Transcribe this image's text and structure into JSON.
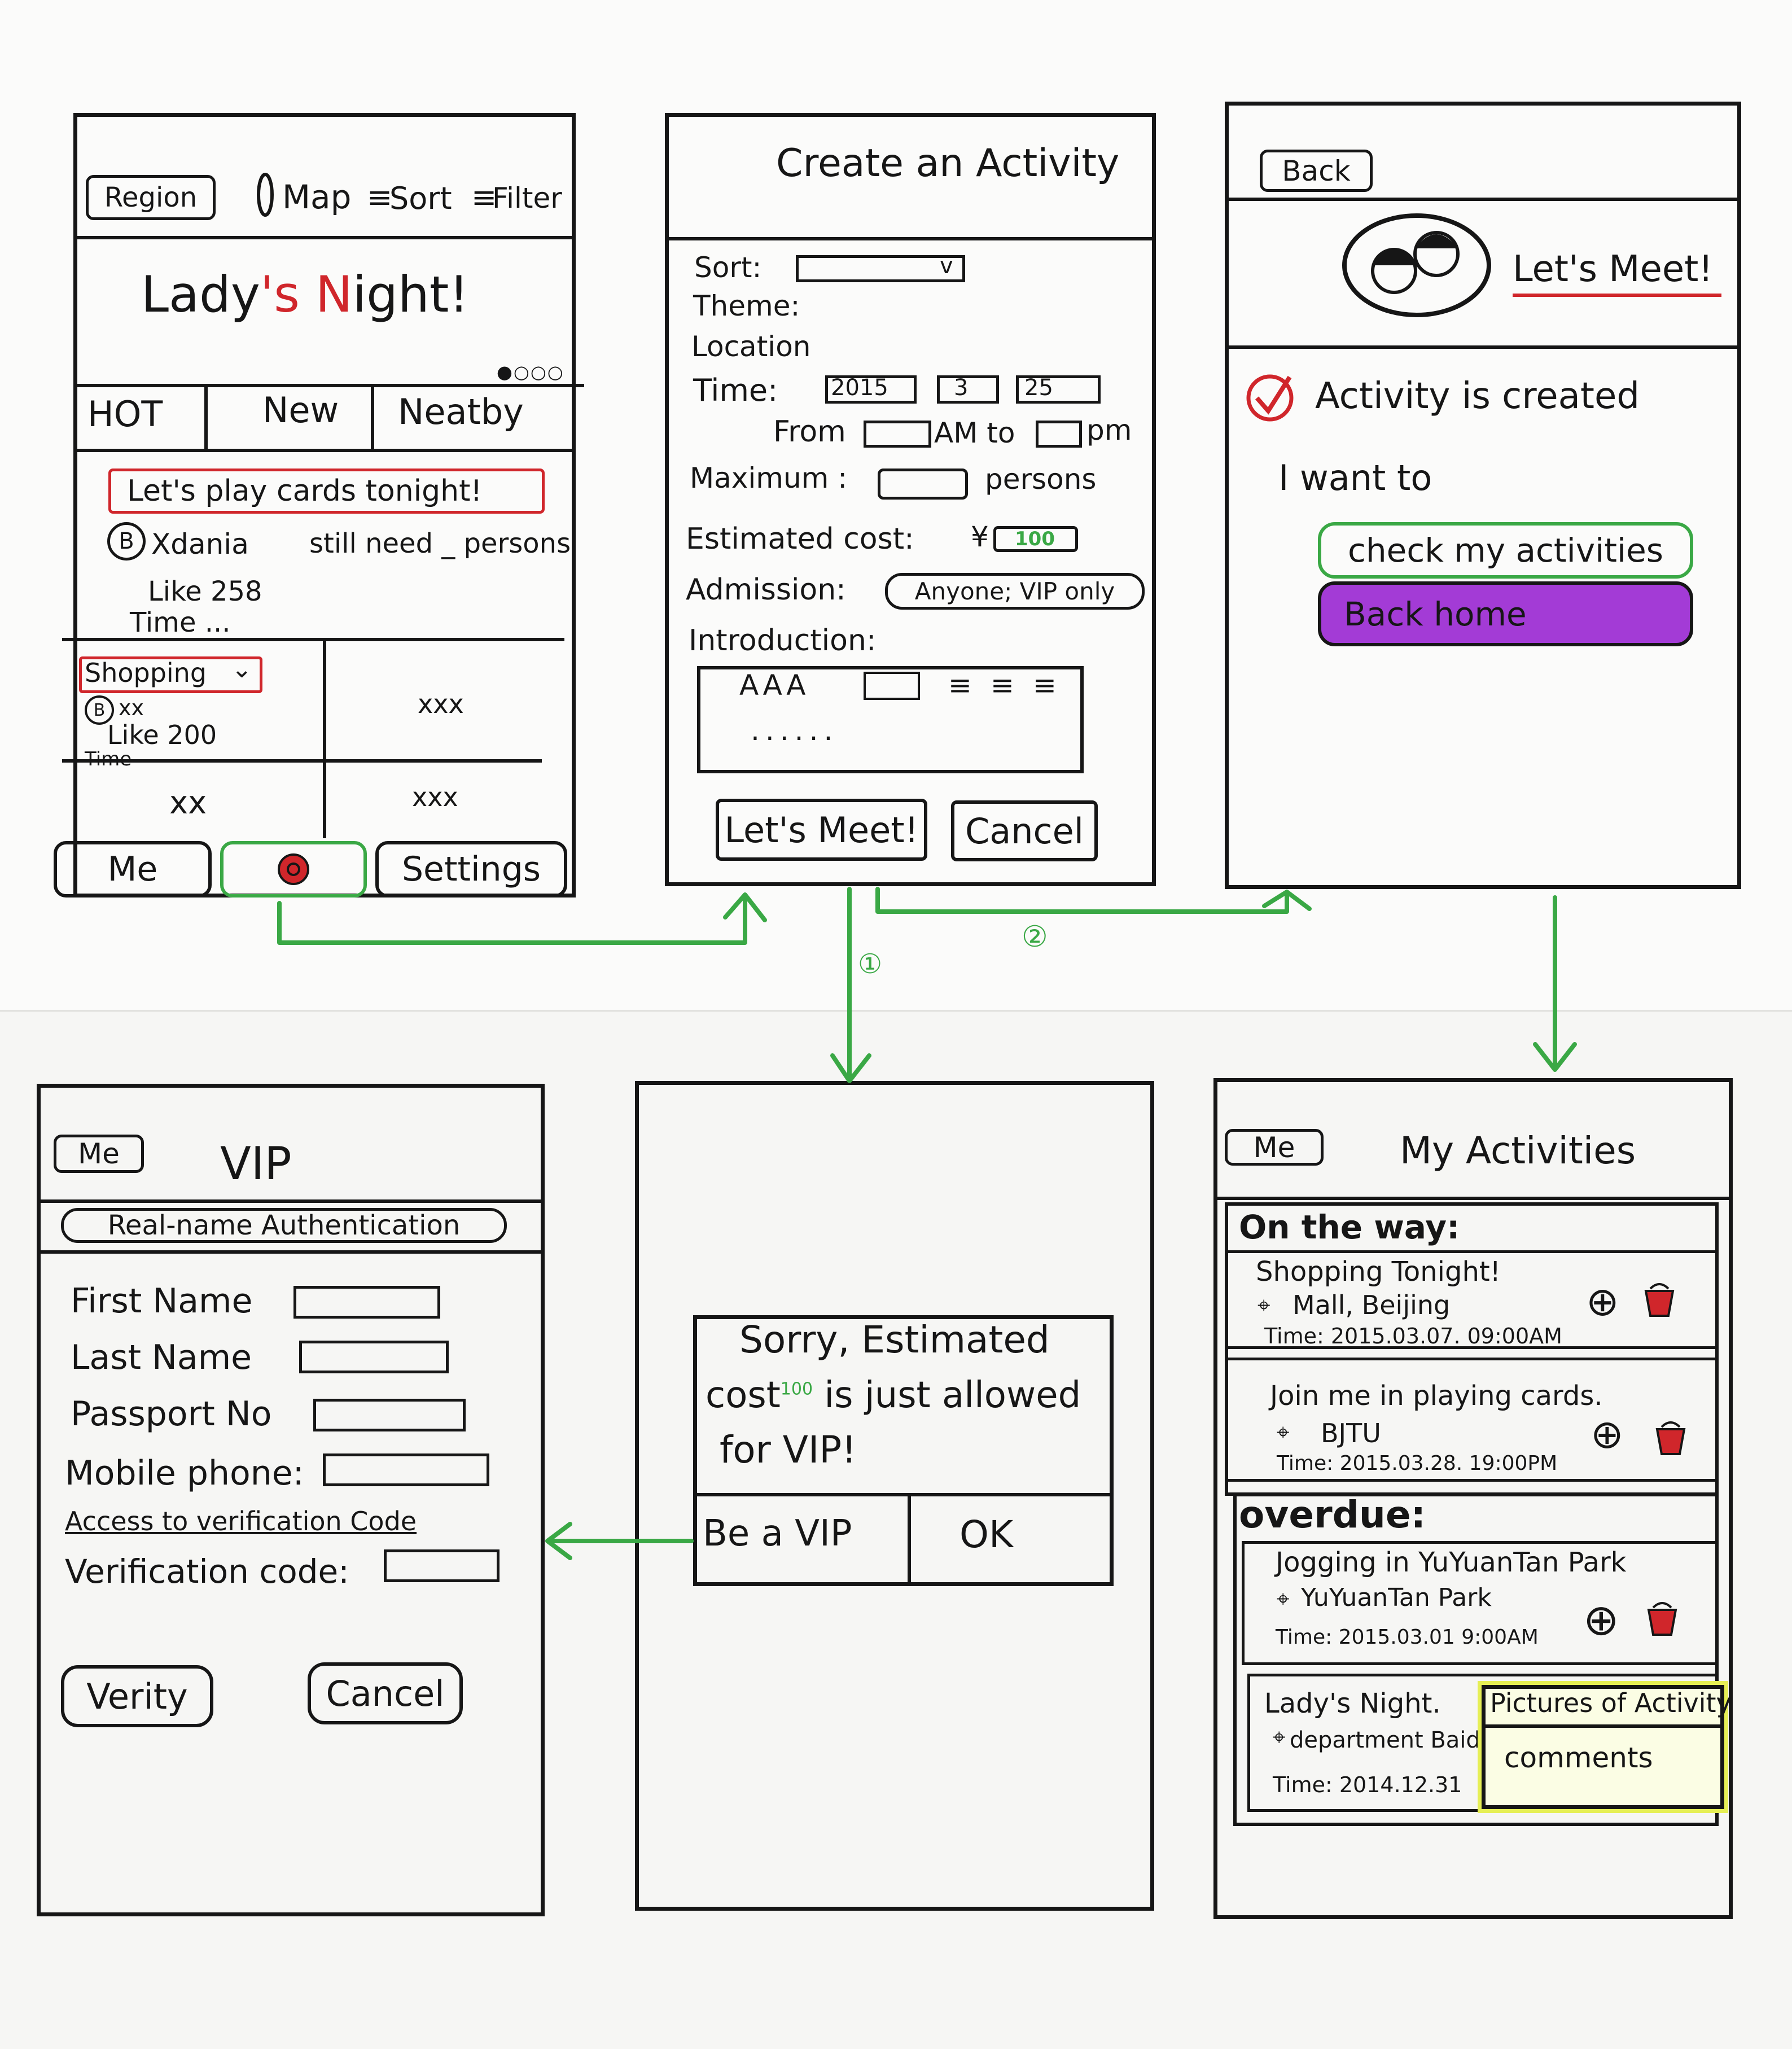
{
  "colors": {
    "ink": "#161616",
    "red": "#d0262b",
    "green": "#3aa845",
    "purple": "#a33bd6",
    "yellow": "#e6ef55"
  },
  "screen_home": {
    "region": "Region",
    "map": "Map",
    "sort": "Sort",
    "filter": "Filter",
    "banner_a": "Lady",
    "banner_b": "'s ",
    "banner_c": "N",
    "banner_d": "ight!",
    "tabs": [
      "HOT",
      "New",
      "Neatby"
    ],
    "post_title": "Let's play cards tonight!",
    "post_user": "Xdania",
    "post_need": "still need _ persons",
    "post_like": "Like 258",
    "post_time": "Time ...",
    "tile1_title": "Shopping",
    "tile1_user": "xx",
    "tile1_like": "Like 200",
    "tile1_time": "Time",
    "tile2": "xxx",
    "tile3": "xx",
    "tile4": "xxx",
    "nav": [
      "Me",
      "Settings"
    ]
  },
  "screen_create": {
    "title": "Create an Activity",
    "sort": "Sort:",
    "theme": "Theme:",
    "location": "Location",
    "time": "Time:",
    "year": "2015",
    "month": "3",
    "day": "25",
    "from": "From",
    "am_to": "AM to",
    "pm": "pm",
    "maximum": "Maximum :",
    "persons": "persons",
    "cost": "Estimated cost:",
    "yen": "¥",
    "cost_value": "100",
    "admission": "Admission:",
    "admission_value": "Anyone; VIP only",
    "intro": "Introduction:",
    "toolbar": "AAA",
    "placeholder": "......",
    "meet_btn": "Let's Meet!",
    "cancel_btn": "Cancel"
  },
  "screen_created": {
    "back": "Back",
    "logo": "Let's Meet!",
    "status": "Activity is created",
    "want": "I want to",
    "check_btn": "check my activities",
    "home_btn": "Back home"
  },
  "screen_vip": {
    "back": "Me",
    "title": "VIP",
    "subtitle": "Real-name Authentication",
    "first": "First Name",
    "last": "Last Name",
    "passport": "Passport No",
    "mobile": "Mobile phone:",
    "access": "Access to verification Code",
    "code": "Verification code:",
    "verify_btn": "Verity",
    "cancel_btn": "Cancel"
  },
  "screen_dialog": {
    "line1": "Sorry, Estimated",
    "line2": "cost",
    "sup": "100",
    "line2b": "is just allowed",
    "line3": "for VIP!",
    "vip_btn": "Be a VIP",
    "ok_btn": "OK"
  },
  "screen_my": {
    "back": "Me",
    "title": "My Activities",
    "way": "On the way:",
    "a1_title": "Shopping Tonight!",
    "a1_loc": "Mall, Beijing",
    "a1_time": "Time: 2015.03.07. 09:00AM",
    "a2_title": "Join me in playing cards.",
    "a2_loc": "BJTU",
    "a2_time": "Time: 2015.03.28. 19:00PM",
    "overdue": "overdue:",
    "a3_title": "Jogging in YuYuanTan Park",
    "a3_loc": "YuYuanTan Park",
    "a3_time": "Time: 2015.03.01 9:00AM",
    "a4_title": "Lady's Night.",
    "a4_loc": "department Baidu",
    "a4_time": "Time: 2014.12.31",
    "popup1": "Pictures of Activity",
    "popup2": "comments"
  },
  "arrows": {
    "label1": "①",
    "label2": "②"
  }
}
